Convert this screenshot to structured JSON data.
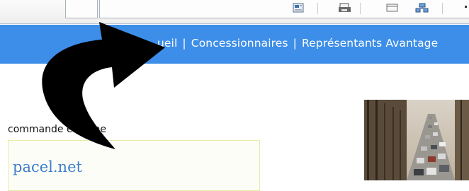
{
  "nav": {
    "visible_start": "ueil",
    "items": [
      "Accueil",
      "Concessionnaires",
      "Représentants Avantage"
    ],
    "separator": "|"
  },
  "content": {
    "section_label": "commande en ligne",
    "link_box_text": "pacel.net"
  },
  "colors": {
    "nav_background": "#3d8ee8",
    "nav_text": "#ffffff",
    "link_text": "#3f7fc9",
    "box_border": "#e6eba2",
    "arrow": "#000000"
  },
  "icons": [
    "page-icon",
    "print-icon",
    "window-icon",
    "network-icon",
    "curved-arrow-icon"
  ]
}
